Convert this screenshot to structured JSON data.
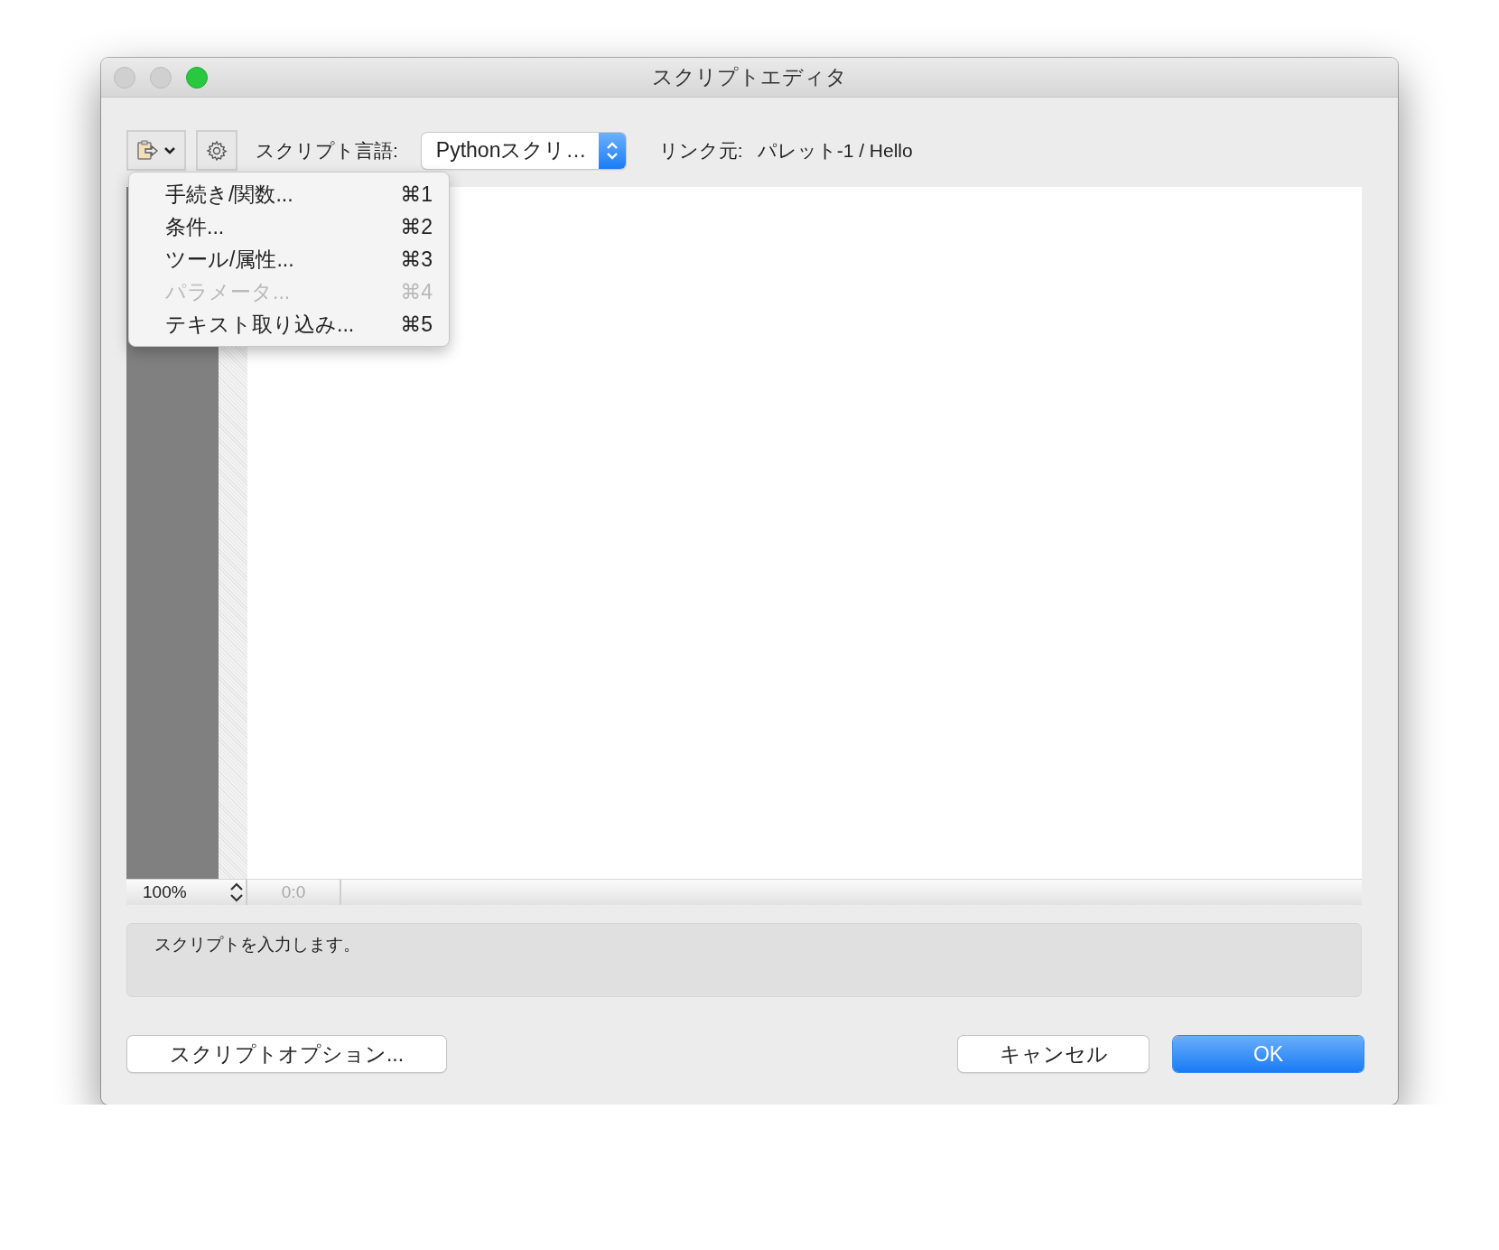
{
  "window": {
    "title": "スクリプトエディタ"
  },
  "toolbar": {
    "language_label": "スクリプト言語:",
    "language_value": "Pythonスクリ…",
    "link_label": "リンク元:",
    "link_value": "パレット-1 / Hello"
  },
  "menu": {
    "items": [
      {
        "label": "手続き/関数...",
        "shortcut": "⌘1",
        "disabled": false
      },
      {
        "label": "条件...",
        "shortcut": "⌘2",
        "disabled": false
      },
      {
        "label": "ツール/属性...",
        "shortcut": "⌘3",
        "disabled": false
      },
      {
        "label": "パラメータ...",
        "shortcut": "⌘4",
        "disabled": true
      },
      {
        "label": "テキスト取り込み...",
        "shortcut": "⌘5",
        "disabled": false
      }
    ]
  },
  "status_bar": {
    "zoom": "100%",
    "position": "0:0"
  },
  "help_text": "スクリプトを入力します。",
  "buttons": [
    {
      "label": "スクリプトオプション...",
      "kind": "normal"
    },
    {
      "label": "キャンセル",
      "kind": "normal"
    },
    {
      "label": "OK",
      "kind": "default"
    }
  ]
}
